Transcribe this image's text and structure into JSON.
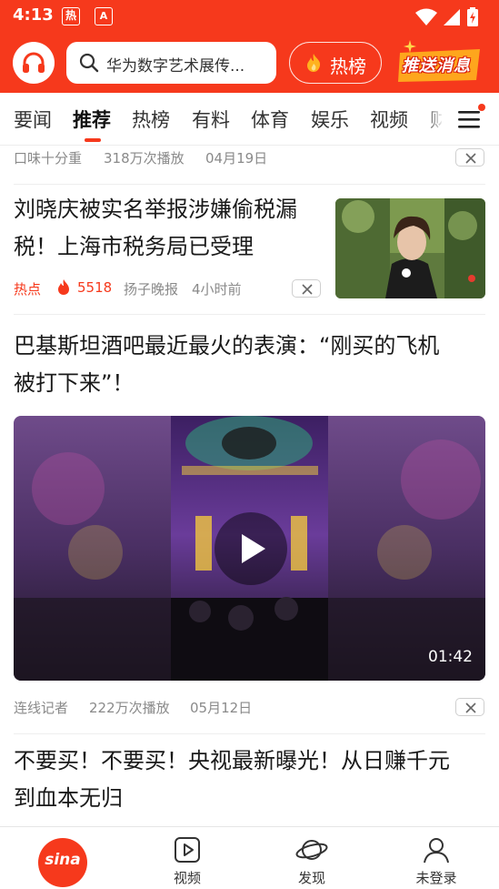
{
  "status_bar": {
    "time": "4:13",
    "app_icon_1": "热",
    "app_icon_2": "A",
    "icons": [
      "wifi-icon",
      "signal-icon",
      "battery-icon"
    ]
  },
  "header": {
    "logo_icon": "headphones-icon",
    "search_placeholder": "华为数字艺术展传...",
    "hot_label": "热榜",
    "push_label": "推送消息"
  },
  "tabs": [
    {
      "label": "要闻"
    },
    {
      "label": "推荐",
      "active": true
    },
    {
      "label": "热榜"
    },
    {
      "label": "有料"
    },
    {
      "label": "体育"
    },
    {
      "label": "娱乐"
    },
    {
      "label": "视频"
    },
    {
      "label": "财"
    }
  ],
  "feed": {
    "item0": {
      "source": "口味十分重",
      "plays": "318万次播放",
      "date": "04月19日"
    },
    "item1": {
      "title_line1": "刘晓庆被实名举报涉嫌偷税漏",
      "title_line2": "税！上海市税务局已受理",
      "tag": "热点",
      "heat": "5518",
      "source": "扬子晚报",
      "time": "4小时前"
    },
    "item2": {
      "title_line1": "巴基斯坦酒吧最近最火的表演：“刚买的飞机",
      "title_line2": "被打下来”！",
      "duration": "01:42",
      "source": "连线记者",
      "plays": "222万次播放",
      "date": "05月12日"
    },
    "item3": {
      "title_line1": "不要买！不要买！央视最新曝光！从日赚千元",
      "title_line2": "到血本无归"
    }
  },
  "bottom_nav": {
    "home_logo": "sina",
    "video_label": "视频",
    "discover_label": "发现",
    "login_label": "未登录"
  },
  "colors": {
    "brand": "#f6391c",
    "hot_tag": "#f6391c",
    "meta": "#8a8a8a"
  }
}
